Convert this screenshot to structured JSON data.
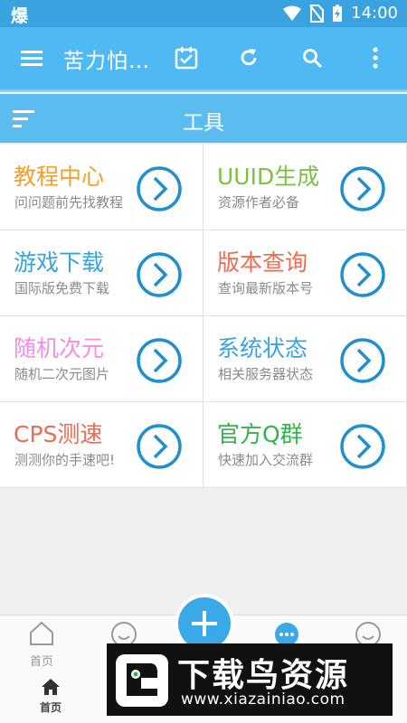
{
  "status_bar": {
    "left_text": "爆",
    "time": "14:00"
  },
  "toolbar": {
    "title": "苦力怕…",
    "icons": [
      "menu-icon",
      "calendar-check-icon",
      "refresh-icon",
      "search-icon",
      "more-vert-icon"
    ]
  },
  "section": {
    "title": "工具"
  },
  "tools": [
    {
      "title": "教程中心",
      "subtitle": "问问题前先找教程",
      "color": "#f0a030"
    },
    {
      "title": "UUID生成",
      "subtitle": "资源作者必备",
      "color": "#7cc242"
    },
    {
      "title": "游戏下载",
      "subtitle": "国际版免费下载",
      "color": "#3aa2df"
    },
    {
      "title": "版本查询",
      "subtitle": "查询最新版本号",
      "color": "#ee6a50"
    },
    {
      "title": "随机次元",
      "subtitle": "随机二次元图片",
      "color": "#f38de6"
    },
    {
      "title": "系统状态",
      "subtitle": "相关服务器状态",
      "color": "#3aa2df"
    },
    {
      "title": "CPS测速",
      "subtitle": "测测你的手速吧!",
      "color": "#ee6a50"
    },
    {
      "title": "官方Q群",
      "subtitle": "快速加入交流群",
      "color": "#2fb54a"
    }
  ],
  "bottom_nav": {
    "home_label": "首页",
    "home_label_2": "首页"
  },
  "watermark": {
    "title": "下载鸟资源",
    "url": "www.xiazainiao.com"
  },
  "colors": {
    "primary": "#4fb9f3",
    "accent": "#3aa9e8",
    "status_bar": "#3aa2df"
  }
}
